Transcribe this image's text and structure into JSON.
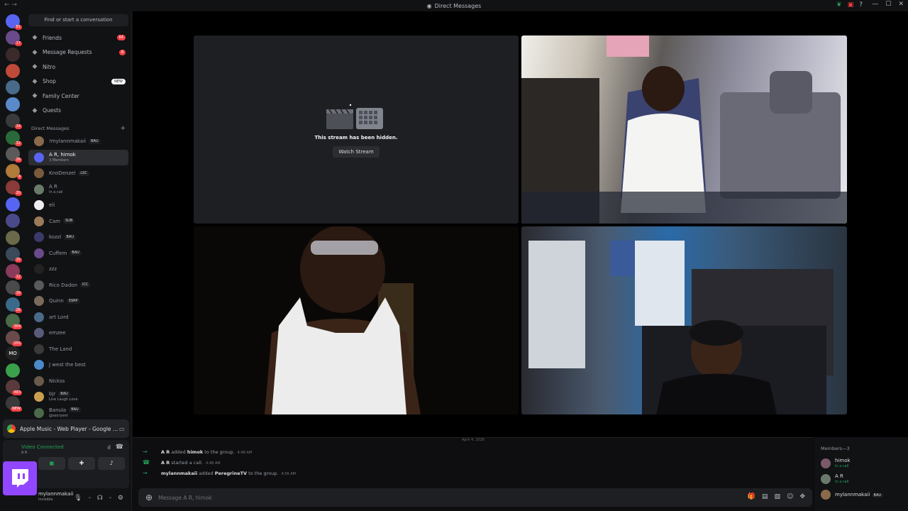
{
  "window": {
    "title": "Direct Messages"
  },
  "search": {
    "placeholder": "Find or start a conversation"
  },
  "nav": [
    {
      "label": "Friends",
      "badge": "64",
      "icon": "friends-icon"
    },
    {
      "label": "Message Requests",
      "badge": "8",
      "icon": "envelope-icon"
    },
    {
      "label": "Nitro",
      "badge": "",
      "icon": "nitro-icon"
    },
    {
      "label": "Shop",
      "badge": "NEW",
      "icon": "shop-icon"
    },
    {
      "label": "Family Center",
      "badge": "",
      "icon": "family-icon"
    },
    {
      "label": "Quests",
      "badge": "",
      "icon": "quests-icon"
    }
  ],
  "dm_header": {
    "label": "Direct Messages",
    "add": "+"
  },
  "dms": [
    {
      "name": "!mylannmakaii",
      "tag": "BAU",
      "sub": "",
      "color": "#8a6a4a"
    },
    {
      "name": "A R, himok",
      "tag": "",
      "sub": "3 Members",
      "color": "#5865f2"
    },
    {
      "name": "KnoDenzel",
      "tag": "LSC",
      "sub": "",
      "color": "#7a5a3a"
    },
    {
      "name": "A R",
      "tag": "",
      "sub": "In a call",
      "color": "#6a7a6a"
    },
    {
      "name": "eli",
      "tag": "",
      "sub": "",
      "color": "#eeeeee"
    },
    {
      "name": "Cam",
      "tag": "SUB",
      "sub": "",
      "color": "#9a7a5a"
    },
    {
      "name": "kozzi",
      "tag": "BAU",
      "sub": "",
      "color": "#3a3a6a"
    },
    {
      "name": "Cuffem",
      "tag": "BAU",
      "sub": "",
      "color": "#6a4a8a"
    },
    {
      "name": "zzz",
      "tag": "",
      "sub": "",
      "color": "#222222"
    },
    {
      "name": "Rico Dadon",
      "tag": "ICC",
      "sub": "",
      "color": "#5a5a5a"
    },
    {
      "name": "Quinn",
      "tag": "SSRP",
      "sub": "",
      "color": "#7a6a5a"
    },
    {
      "name": "art Lord",
      "tag": "",
      "sub": "",
      "color": "#4a6a8a"
    },
    {
      "name": "emzee",
      "tag": "",
      "sub": "",
      "color": "#5a5a7a"
    },
    {
      "name": "The Land",
      "tag": "",
      "sub": "",
      "color": "#3a3a3a"
    },
    {
      "name": "J west the best",
      "tag": "",
      "sub": "",
      "color": "#4a8aca"
    },
    {
      "name": "Nickss",
      "tag": "",
      "sub": "",
      "color": "#6a5a4a"
    },
    {
      "name": "bjr",
      "tag": "BAU",
      "sub": "Live Laugh Love",
      "color": "#caa050"
    },
    {
      "name": "Banula",
      "tag": "BAU",
      "sub": "@secryent",
      "color": "#4a6a4a"
    }
  ],
  "activity": {
    "label": "Apple Music - Web Player - Google ..."
  },
  "voice": {
    "status": "Video Connected",
    "sub": "A R"
  },
  "user": {
    "name": "mylannmakaii",
    "status": "Invisible"
  },
  "stream": {
    "hidden_text": "This stream has been hidden.",
    "button": "Watch Stream"
  },
  "chat": {
    "date": "April 4, 2026",
    "messages": [
      {
        "actor": "A R",
        "text1": " added ",
        "target": "himok",
        "text2": " to the group.",
        "time": "4:48 AM",
        "icon": "arrow-right-icon"
      },
      {
        "actor": "A R",
        "text1": " started a call.",
        "target": "",
        "text2": "",
        "time": "4:48 AM",
        "icon": "phone-icon"
      },
      {
        "actor": "mylannmakaii",
        "text1": " added ",
        "target": "PeregrineTV",
        "text2": " to the group.",
        "time": "4:56 AM",
        "icon": "arrow-right-icon"
      }
    ],
    "placeholder": "Message A R, himok"
  },
  "members": {
    "header": "Members—3",
    "list": [
      {
        "name": "himok",
        "sub": "In a call",
        "color": "#7a5a6a"
      },
      {
        "name": "A R",
        "sub": "In a call",
        "color": "#6a7a6a"
      },
      {
        "name": "mylannmakaii",
        "sub": "",
        "tag": "BAU",
        "color": "#8a6a4a"
      }
    ]
  },
  "servers": [
    {
      "badge": "81",
      "color": "#5865f2"
    },
    {
      "badge": "17",
      "color": "#6a4a8a"
    },
    {
      "badge": "",
      "color": "#3a2a2a"
    },
    {
      "badge": "",
      "color": "#c04a3a"
    },
    {
      "badge": "",
      "color": "#4a6a8a"
    },
    {
      "badge": "",
      "color": "#5a8aca"
    },
    {
      "badge": "14",
      "color": "#3a3a3a"
    },
    {
      "badge": "32",
      "color": "#2a6a3a"
    },
    {
      "badge": "26",
      "color": "#5a5a5a"
    },
    {
      "badge": "4",
      "color": "#b07a3a"
    },
    {
      "badge": "20",
      "color": "#8a3a3a"
    },
    {
      "badge": "",
      "color": "#5865f2"
    },
    {
      "badge": "",
      "color": "#4a4a8a"
    },
    {
      "badge": "",
      "color": "#6a6a4a"
    },
    {
      "badge": "15",
      "color": "#3a4a5a"
    },
    {
      "badge": "12",
      "color": "#8a3a5a"
    },
    {
      "badge": "16",
      "color": "#4a4a4a"
    },
    {
      "badge": "26",
      "color": "#3a6a8a"
    },
    {
      "badge": "304",
      "color": "#4a6a4a"
    },
    {
      "badge": "255",
      "color": "#6a4a4a"
    },
    {
      "badge": "",
      "color": "#222222",
      "text": "MO"
    },
    {
      "badge": "",
      "color": "#3aa04a"
    },
    {
      "badge": "483",
      "color": "#5a3a3a"
    },
    {
      "badge": "NEW",
      "color": "#3a3a3a"
    }
  ]
}
